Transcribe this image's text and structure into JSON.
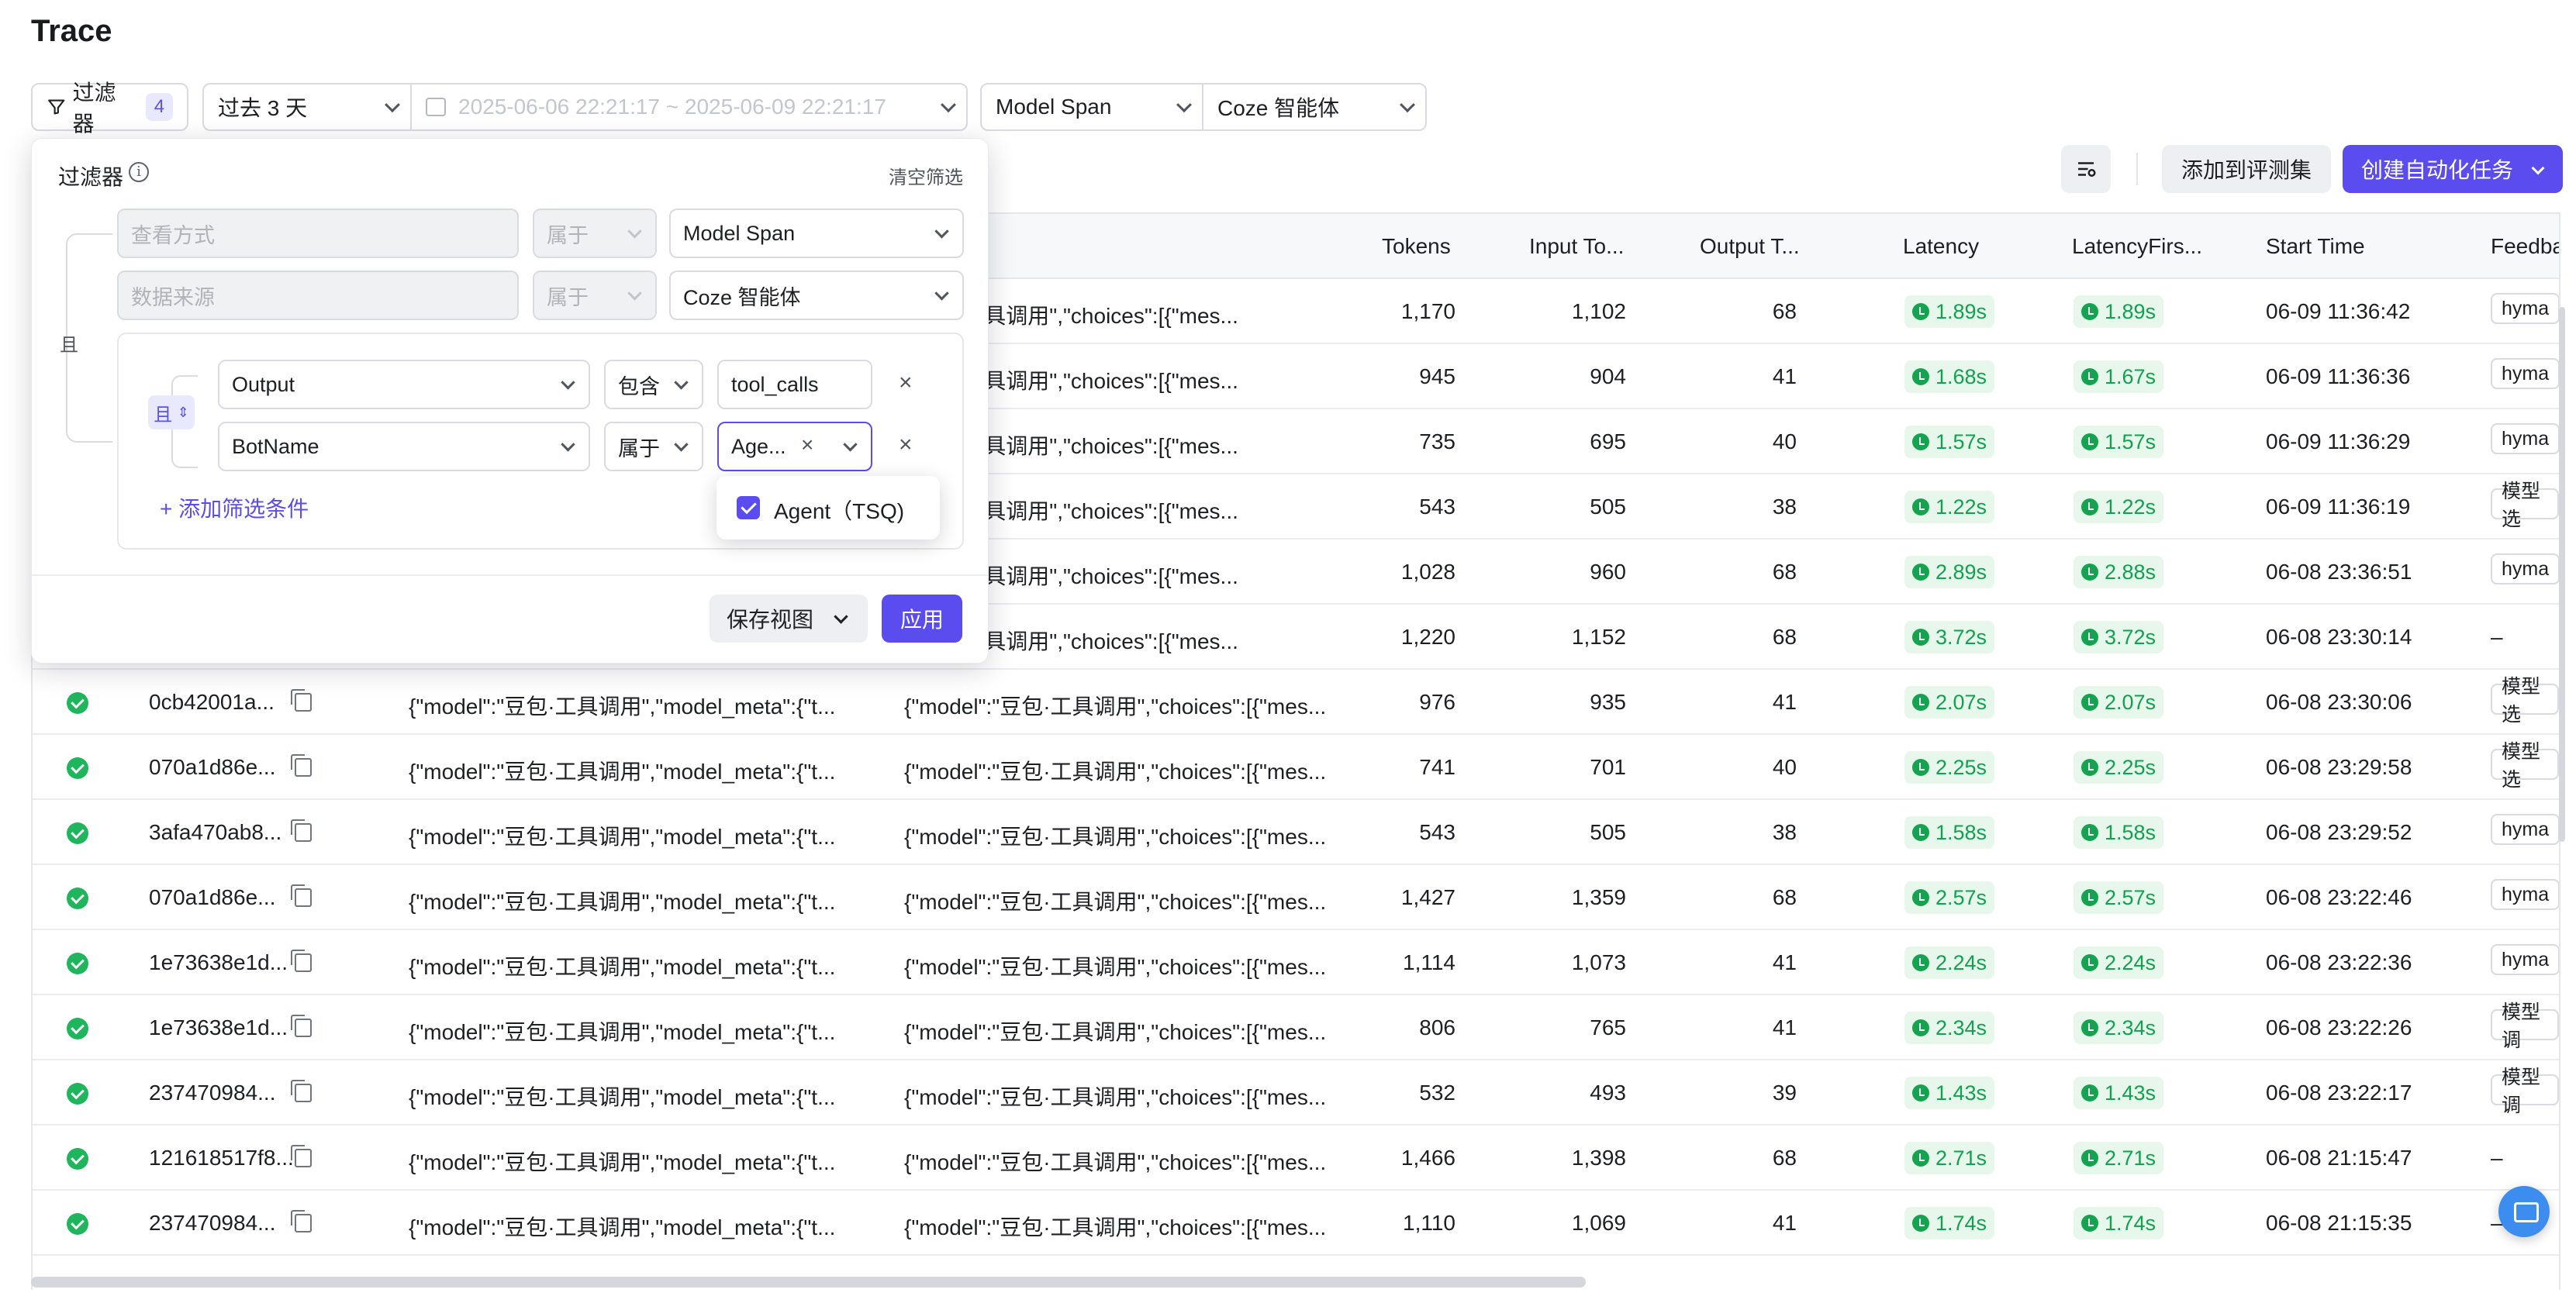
{
  "page": {
    "title": "Trace"
  },
  "toolbar": {
    "filter_label": "过滤器",
    "filter_count": "4",
    "time_preset": "过去 3 天",
    "time_range": "2025-06-06 22:21:17 ~ 2025-06-09 22:21:17",
    "span_type": "Model Span",
    "platform": "Coze 智能体",
    "add_to_eval": "添加到评测集",
    "create_task": "创建自动化任务"
  },
  "filter_panel": {
    "title": "过滤器",
    "clear": "清空筛选",
    "outer_and": "且",
    "row1": {
      "field_placeholder": "查看方式",
      "op": "属于",
      "value": "Model Span"
    },
    "row2": {
      "field_placeholder": "数据来源",
      "op": "属于",
      "value": "Coze 智能体"
    },
    "inner_and": "且",
    "cond1": {
      "field": "Output",
      "op": "包含",
      "value": "tool_calls"
    },
    "cond2": {
      "field": "BotName",
      "op": "属于",
      "value": "Age..."
    },
    "add_condition": "添加筛选条件",
    "save_view": "保存视图",
    "apply": "应用",
    "dropdown_option": "Agent（TSQ)"
  },
  "table": {
    "columns": [
      "Tokens",
      "Input To...",
      "Output T...",
      "Latency",
      "LatencyFirs...",
      "Start Time",
      "Feedba"
    ],
    "rows": [
      {
        "id": "",
        "input": "",
        "output": "\"豆包·工具调用\",\"choices\":[{\"mes...",
        "tokens": "1,170",
        "in": "1,102",
        "out": "68",
        "lat": "1.89s",
        "first": "1.89s",
        "start": "06-09 11:36:42",
        "fb": "hyma"
      },
      {
        "id": "",
        "input": "",
        "output": "\"豆包·工具调用\",\"choices\":[{\"mes...",
        "tokens": "945",
        "in": "904",
        "out": "41",
        "lat": "1.68s",
        "first": "1.67s",
        "start": "06-09 11:36:36",
        "fb": "hyma"
      },
      {
        "id": "",
        "input": "",
        "output": "\"豆包·工具调用\",\"choices\":[{\"mes...",
        "tokens": "735",
        "in": "695",
        "out": "40",
        "lat": "1.57s",
        "first": "1.57s",
        "start": "06-09 11:36:29",
        "fb": "hyma"
      },
      {
        "id": "",
        "input": "",
        "output": "\"豆包·工具调用\",\"choices\":[{\"mes...",
        "tokens": "543",
        "in": "505",
        "out": "38",
        "lat": "1.22s",
        "first": "1.22s",
        "start": "06-09 11:36:19",
        "fb": "模型选"
      },
      {
        "id": "",
        "input": "",
        "output": "\"豆包·工具调用\",\"choices\":[{\"mes...",
        "tokens": "1,028",
        "in": "960",
        "out": "68",
        "lat": "2.89s",
        "first": "2.88s",
        "start": "06-08 23:36:51",
        "fb": "hyma"
      },
      {
        "id": "",
        "input": "",
        "output": "\"豆包·工具调用\",\"choices\":[{\"mes...",
        "tokens": "1,220",
        "in": "1,152",
        "out": "68",
        "lat": "3.72s",
        "first": "3.72s",
        "start": "06-08 23:30:14",
        "fb": "–"
      },
      {
        "id": "0cb42001a...",
        "input": "{\"model\":\"豆包·工具调用\",\"model_meta\":{\"t...",
        "output": "{\"model\":\"豆包·工具调用\",\"choices\":[{\"mes...",
        "tokens": "976",
        "in": "935",
        "out": "41",
        "lat": "2.07s",
        "first": "2.07s",
        "start": "06-08 23:30:06",
        "fb": "模型选"
      },
      {
        "id": "070a1d86e...",
        "input": "{\"model\":\"豆包·工具调用\",\"model_meta\":{\"t...",
        "output": "{\"model\":\"豆包·工具调用\",\"choices\":[{\"mes...",
        "tokens": "741",
        "in": "701",
        "out": "40",
        "lat": "2.25s",
        "first": "2.25s",
        "start": "06-08 23:29:58",
        "fb": "模型选"
      },
      {
        "id": "3afa470ab8...",
        "input": "{\"model\":\"豆包·工具调用\",\"model_meta\":{\"t...",
        "output": "{\"model\":\"豆包·工具调用\",\"choices\":[{\"mes...",
        "tokens": "543",
        "in": "505",
        "out": "38",
        "lat": "1.58s",
        "first": "1.58s",
        "start": "06-08 23:29:52",
        "fb": "hyma"
      },
      {
        "id": "070a1d86e...",
        "input": "{\"model\":\"豆包·工具调用\",\"model_meta\":{\"t...",
        "output": "{\"model\":\"豆包·工具调用\",\"choices\":[{\"mes...",
        "tokens": "1,427",
        "in": "1,359",
        "out": "68",
        "lat": "2.57s",
        "first": "2.57s",
        "start": "06-08 23:22:46",
        "fb": "hyma"
      },
      {
        "id": "1e73638e1d...",
        "input": "{\"model\":\"豆包·工具调用\",\"model_meta\":{\"t...",
        "output": "{\"model\":\"豆包·工具调用\",\"choices\":[{\"mes...",
        "tokens": "1,114",
        "in": "1,073",
        "out": "41",
        "lat": "2.24s",
        "first": "2.24s",
        "start": "06-08 23:22:36",
        "fb": "hyma"
      },
      {
        "id": "1e73638e1d...",
        "input": "{\"model\":\"豆包·工具调用\",\"model_meta\":{\"t...",
        "output": "{\"model\":\"豆包·工具调用\",\"choices\":[{\"mes...",
        "tokens": "806",
        "in": "765",
        "out": "41",
        "lat": "2.34s",
        "first": "2.34s",
        "start": "06-08 23:22:26",
        "fb": "模型调"
      },
      {
        "id": "237470984...",
        "input": "{\"model\":\"豆包·工具调用\",\"model_meta\":{\"t...",
        "output": "{\"model\":\"豆包·工具调用\",\"choices\":[{\"mes...",
        "tokens": "532",
        "in": "493",
        "out": "39",
        "lat": "1.43s",
        "first": "1.43s",
        "start": "06-08 23:22:17",
        "fb": "模型调"
      },
      {
        "id": "121618517f8...",
        "input": "{\"model\":\"豆包·工具调用\",\"model_meta\":{\"t...",
        "output": "{\"model\":\"豆包·工具调用\",\"choices\":[{\"mes...",
        "tokens": "1,466",
        "in": "1,398",
        "out": "68",
        "lat": "2.71s",
        "first": "2.71s",
        "start": "06-08 21:15:47",
        "fb": "–"
      },
      {
        "id": "237470984...",
        "input": "{\"model\":\"豆包·工具调用\",\"model_meta\":{\"t...",
        "output": "{\"model\":\"豆包·工具调用\",\"choices\":[{\"mes...",
        "tokens": "1,110",
        "in": "1,069",
        "out": "41",
        "lat": "1.74s",
        "first": "1.74s",
        "start": "06-08 21:15:35",
        "fb": "–"
      }
    ]
  }
}
